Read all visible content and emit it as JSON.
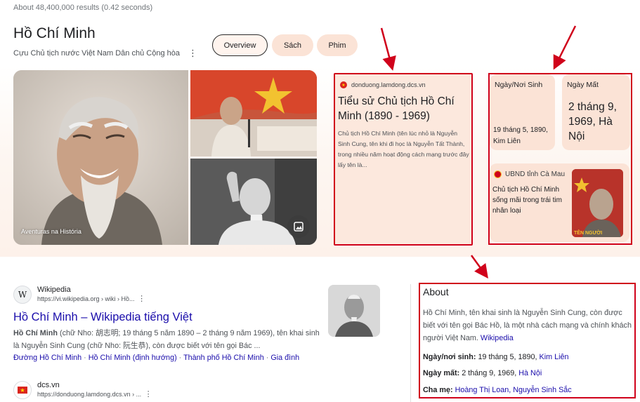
{
  "result_stats": "About 48,400,000 results (0.42 seconds)",
  "entity": {
    "title": "Hồ Chí Minh",
    "subtitle": "Cựu Chủ tịch nước Việt Nam Dân chủ Cộng hòa",
    "more_icon": "⋮"
  },
  "chips": [
    {
      "label": "Overview",
      "selected": true
    },
    {
      "label": "Sách",
      "selected": false
    },
    {
      "label": "Phim",
      "selected": false
    }
  ],
  "images": {
    "main_caption": "Aventuras na História"
  },
  "bio_card": {
    "source": "donduong.lamdong.dcs.vn",
    "title": "Tiểu sử Chủ tịch Hồ Chí Minh (1890 - 1969)",
    "snippet": "Chủ tịch Hồ Chí Minh (tên lúc nhỏ là Nguyễn Sinh Cung, tên khi đi học là Nguyễn Tất Thành, trong nhiều năm hoạt động cách mạng trước đây lấy tên là..."
  },
  "born_card": {
    "label": "Ngày/Nơi Sinh",
    "value": "19 tháng 5, 1890, Kim Liên"
  },
  "died_card": {
    "label": "Ngày Mất",
    "value": "2 tháng 9, 1969, Hà Nội"
  },
  "news_card": {
    "source": "UBND tỉnh Cà Mau",
    "title": "Chủ tịch Hồ Chí Minh sống mãi trong trái tim nhân loại",
    "thumb_text": "TÊN NGƯỜI"
  },
  "results": [
    {
      "site": "Wikipedia",
      "url": "https://vi.wikipedia.org › wiki › Hồ...",
      "title": "Hồ Chí Minh – Wikipedia tiếng Việt",
      "snippet_bold": "Hồ Chí Minh",
      "snippet": " (chữ Nho: 胡志明; 19 tháng 5 năm 1890 – 2 tháng 9 năm 1969), tên khai sinh là Nguyễn Sinh Cung (chữ Nho: 阮生恭), còn được biết với tên gọi Bác ...",
      "sublinks": [
        "Đường Hồ Chí Minh",
        "Hồ Chí Minh (định hướng)",
        "Thành phố Hồ Chí Minh",
        "Gia đình"
      ]
    },
    {
      "site": "dcs.vn",
      "url": "https://donduong.lamdong.dcs.vn › ..."
    }
  ],
  "about": {
    "heading": "About",
    "desc_prefix": "Hồ Chí Minh, tên khai sinh là Nguyễn Sinh Cung, còn được biết với tên gọi Bác Hồ, là một nhà cách mạng và chính khách người Việt Nam. ",
    "desc_link": "Wikipedia",
    "facts": [
      {
        "label": "Ngày/nơi sinh:",
        "text": " 19 tháng 5, 1890, ",
        "link": "Kim Liên"
      },
      {
        "label": "Ngày mất:",
        "text": " 2 tháng 9, 1969, ",
        "link": "Hà Nội"
      },
      {
        "label": "Cha mẹ:",
        "text": " ",
        "link": "Hoàng Thị Loan, Nguyễn Sinh Sắc"
      }
    ]
  },
  "colors": {
    "annotation_red": "#d0021b",
    "link_blue": "#1a0dab",
    "card_bg": "#fbe3d6"
  }
}
